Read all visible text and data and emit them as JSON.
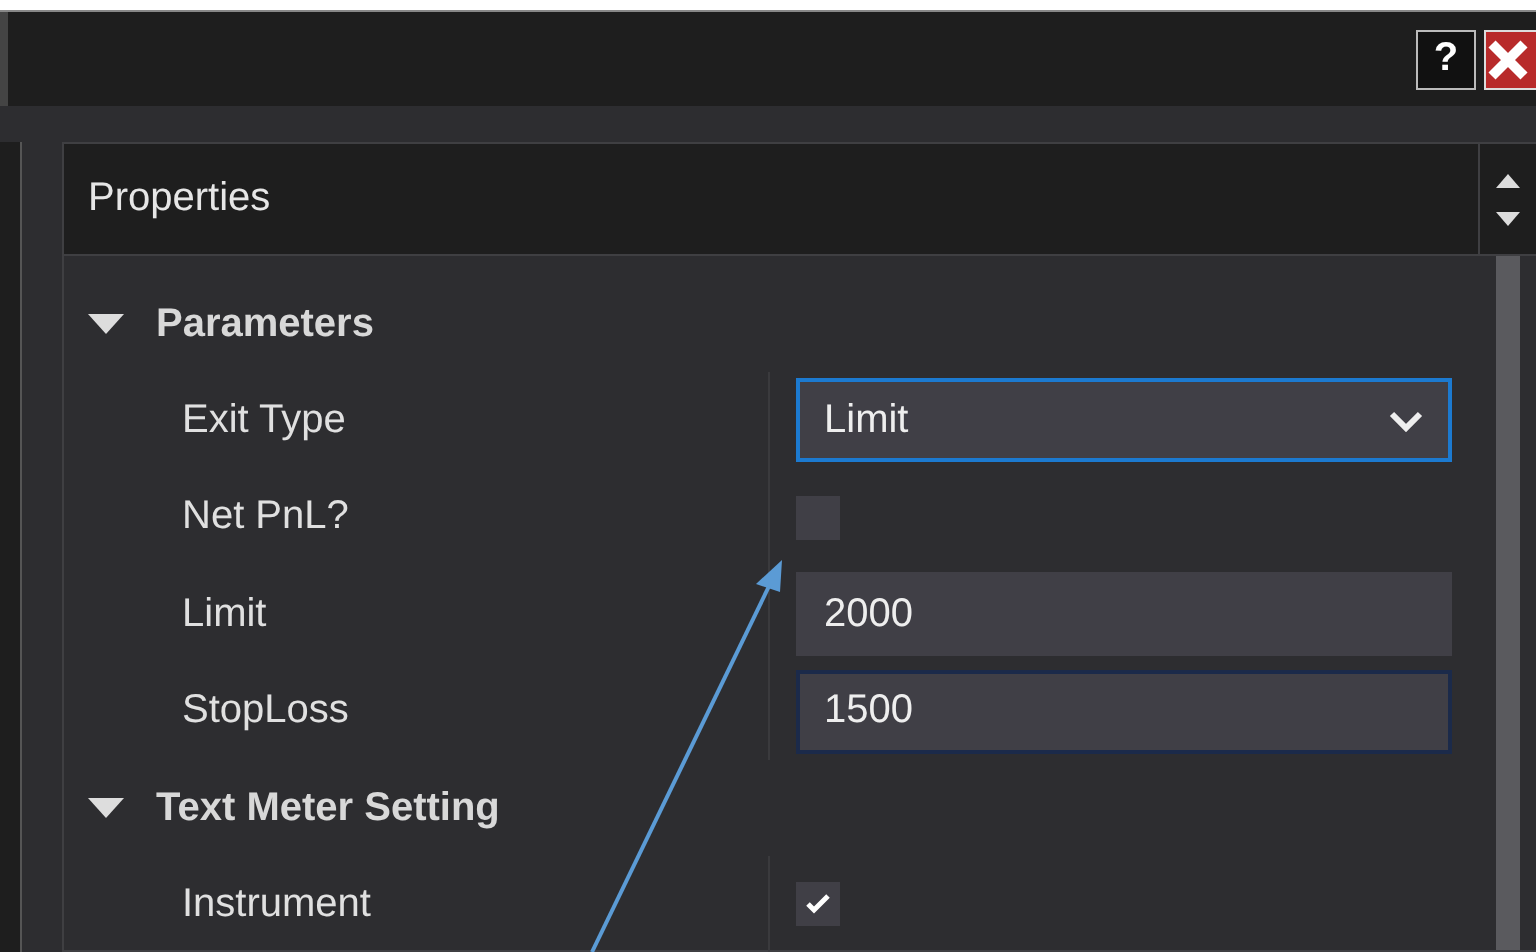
{
  "window": {
    "help_button": "?",
    "close_button": true
  },
  "properties_panel": {
    "title": "Properties",
    "categories": [
      {
        "name": "Parameters",
        "expanded": true,
        "properties": [
          {
            "label": "Exit Type",
            "kind": "dropdown",
            "value": "Limit",
            "focused": true,
            "hovered": false
          },
          {
            "label": "Net PnL?",
            "kind": "checkbox",
            "checked": false
          },
          {
            "label": "Limit",
            "kind": "text",
            "value": "2000",
            "focused": false,
            "hovered": false
          },
          {
            "label": "StopLoss",
            "kind": "text",
            "value": "1500",
            "focused": false,
            "hovered": true
          }
        ]
      },
      {
        "name": "Text Meter Setting",
        "expanded": true,
        "properties": [
          {
            "label": "Instrument",
            "kind": "checkbox",
            "checked": true
          }
        ]
      }
    ]
  }
}
